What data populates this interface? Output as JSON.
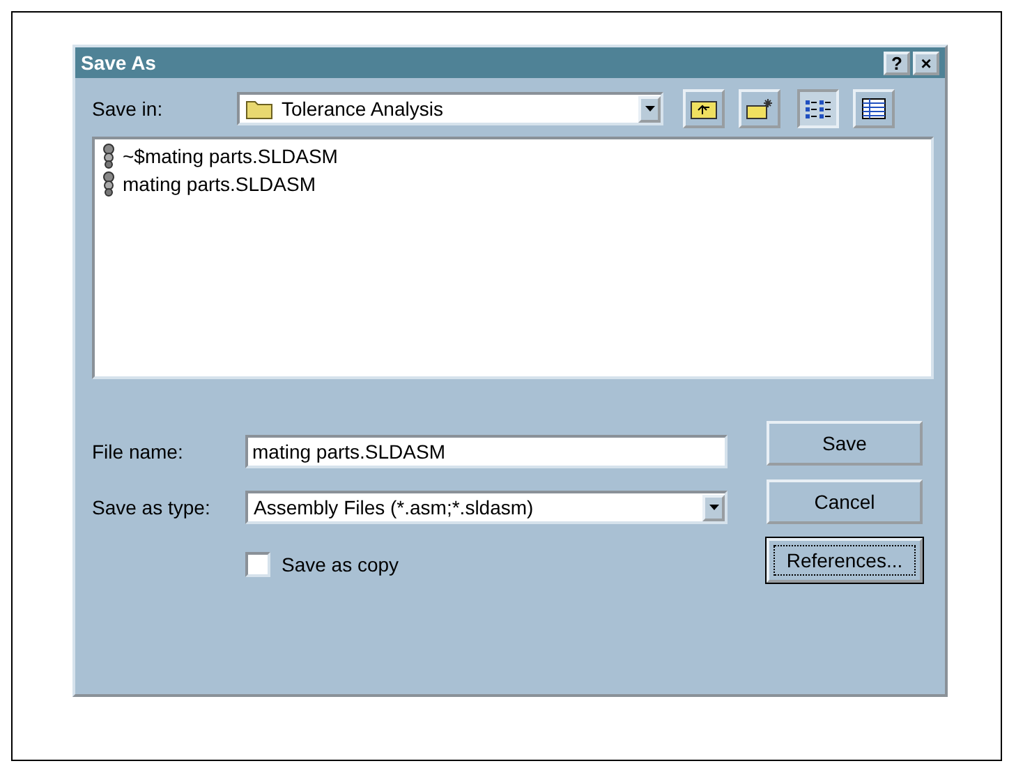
{
  "window": {
    "title": "Save As",
    "title_buttons": [
      "?",
      "×"
    ]
  },
  "save_in": {
    "label": "Save in:",
    "value": "Tolerance Analysis"
  },
  "toolbar": [
    {
      "kind": "up",
      "selected": false
    },
    {
      "kind": "new-folder",
      "selected": false
    },
    {
      "kind": "list",
      "selected": true
    },
    {
      "kind": "details",
      "selected": false
    }
  ],
  "files": [
    {
      "name": "~$mating parts.SLDASM"
    },
    {
      "name": "mating parts.SLDASM"
    }
  ],
  "file_name": {
    "label": "File name:",
    "value": "mating parts.SLDASM"
  },
  "save_as_type": {
    "label": "Save as type:",
    "value": "Assembly Files (*.asm;*.sldasm)"
  },
  "save_as_copy": {
    "label": "Save as copy",
    "checked": false
  },
  "buttons": [
    {
      "label": "Save",
      "focused": false
    },
    {
      "label": "Cancel",
      "focused": false
    },
    {
      "label": "References...",
      "focused": true
    }
  ]
}
